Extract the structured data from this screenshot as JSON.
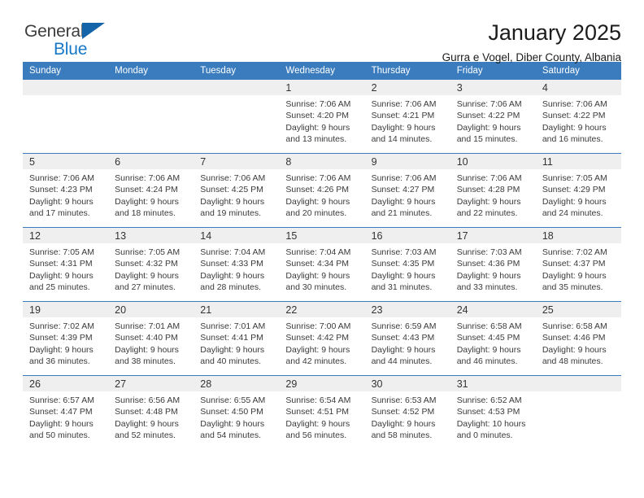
{
  "brand": {
    "name_part1": "General",
    "name_part2": "Blue",
    "triangle_color": "#1464aa"
  },
  "header": {
    "title": "January 2025",
    "subtitle": "Gurra e Vogel, Diber County, Albania"
  },
  "theme": {
    "header_blue": "#3a7cbe",
    "daynum_background": "#efefef",
    "text": "#333333"
  },
  "calendar": {
    "weekday_headers": [
      "Sunday",
      "Monday",
      "Tuesday",
      "Wednesday",
      "Thursday",
      "Friday",
      "Saturday"
    ],
    "weeks": [
      [
        {
          "day": "",
          "empty": true
        },
        {
          "day": "",
          "empty": true
        },
        {
          "day": "",
          "empty": true
        },
        {
          "day": "1",
          "sunrise": "Sunrise: 7:06 AM",
          "sunset": "Sunset: 4:20 PM",
          "daylight_line1": "Daylight: 9 hours",
          "daylight_line2": "and 13 minutes."
        },
        {
          "day": "2",
          "sunrise": "Sunrise: 7:06 AM",
          "sunset": "Sunset: 4:21 PM",
          "daylight_line1": "Daylight: 9 hours",
          "daylight_line2": "and 14 minutes."
        },
        {
          "day": "3",
          "sunrise": "Sunrise: 7:06 AM",
          "sunset": "Sunset: 4:22 PM",
          "daylight_line1": "Daylight: 9 hours",
          "daylight_line2": "and 15 minutes."
        },
        {
          "day": "4",
          "sunrise": "Sunrise: 7:06 AM",
          "sunset": "Sunset: 4:22 PM",
          "daylight_line1": "Daylight: 9 hours",
          "daylight_line2": "and 16 minutes."
        }
      ],
      [
        {
          "day": "5",
          "sunrise": "Sunrise: 7:06 AM",
          "sunset": "Sunset: 4:23 PM",
          "daylight_line1": "Daylight: 9 hours",
          "daylight_line2": "and 17 minutes."
        },
        {
          "day": "6",
          "sunrise": "Sunrise: 7:06 AM",
          "sunset": "Sunset: 4:24 PM",
          "daylight_line1": "Daylight: 9 hours",
          "daylight_line2": "and 18 minutes."
        },
        {
          "day": "7",
          "sunrise": "Sunrise: 7:06 AM",
          "sunset": "Sunset: 4:25 PM",
          "daylight_line1": "Daylight: 9 hours",
          "daylight_line2": "and 19 minutes."
        },
        {
          "day": "8",
          "sunrise": "Sunrise: 7:06 AM",
          "sunset": "Sunset: 4:26 PM",
          "daylight_line1": "Daylight: 9 hours",
          "daylight_line2": "and 20 minutes."
        },
        {
          "day": "9",
          "sunrise": "Sunrise: 7:06 AM",
          "sunset": "Sunset: 4:27 PM",
          "daylight_line1": "Daylight: 9 hours",
          "daylight_line2": "and 21 minutes."
        },
        {
          "day": "10",
          "sunrise": "Sunrise: 7:06 AM",
          "sunset": "Sunset: 4:28 PM",
          "daylight_line1": "Daylight: 9 hours",
          "daylight_line2": "and 22 minutes."
        },
        {
          "day": "11",
          "sunrise": "Sunrise: 7:05 AM",
          "sunset": "Sunset: 4:29 PM",
          "daylight_line1": "Daylight: 9 hours",
          "daylight_line2": "and 24 minutes."
        }
      ],
      [
        {
          "day": "12",
          "sunrise": "Sunrise: 7:05 AM",
          "sunset": "Sunset: 4:31 PM",
          "daylight_line1": "Daylight: 9 hours",
          "daylight_line2": "and 25 minutes."
        },
        {
          "day": "13",
          "sunrise": "Sunrise: 7:05 AM",
          "sunset": "Sunset: 4:32 PM",
          "daylight_line1": "Daylight: 9 hours",
          "daylight_line2": "and 27 minutes."
        },
        {
          "day": "14",
          "sunrise": "Sunrise: 7:04 AM",
          "sunset": "Sunset: 4:33 PM",
          "daylight_line1": "Daylight: 9 hours",
          "daylight_line2": "and 28 minutes."
        },
        {
          "day": "15",
          "sunrise": "Sunrise: 7:04 AM",
          "sunset": "Sunset: 4:34 PM",
          "daylight_line1": "Daylight: 9 hours",
          "daylight_line2": "and 30 minutes."
        },
        {
          "day": "16",
          "sunrise": "Sunrise: 7:03 AM",
          "sunset": "Sunset: 4:35 PM",
          "daylight_line1": "Daylight: 9 hours",
          "daylight_line2": "and 31 minutes."
        },
        {
          "day": "17",
          "sunrise": "Sunrise: 7:03 AM",
          "sunset": "Sunset: 4:36 PM",
          "daylight_line1": "Daylight: 9 hours",
          "daylight_line2": "and 33 minutes."
        },
        {
          "day": "18",
          "sunrise": "Sunrise: 7:02 AM",
          "sunset": "Sunset: 4:37 PM",
          "daylight_line1": "Daylight: 9 hours",
          "daylight_line2": "and 35 minutes."
        }
      ],
      [
        {
          "day": "19",
          "sunrise": "Sunrise: 7:02 AM",
          "sunset": "Sunset: 4:39 PM",
          "daylight_line1": "Daylight: 9 hours",
          "daylight_line2": "and 36 minutes."
        },
        {
          "day": "20",
          "sunrise": "Sunrise: 7:01 AM",
          "sunset": "Sunset: 4:40 PM",
          "daylight_line1": "Daylight: 9 hours",
          "daylight_line2": "and 38 minutes."
        },
        {
          "day": "21",
          "sunrise": "Sunrise: 7:01 AM",
          "sunset": "Sunset: 4:41 PM",
          "daylight_line1": "Daylight: 9 hours",
          "daylight_line2": "and 40 minutes."
        },
        {
          "day": "22",
          "sunrise": "Sunrise: 7:00 AM",
          "sunset": "Sunset: 4:42 PM",
          "daylight_line1": "Daylight: 9 hours",
          "daylight_line2": "and 42 minutes."
        },
        {
          "day": "23",
          "sunrise": "Sunrise: 6:59 AM",
          "sunset": "Sunset: 4:43 PM",
          "daylight_line1": "Daylight: 9 hours",
          "daylight_line2": "and 44 minutes."
        },
        {
          "day": "24",
          "sunrise": "Sunrise: 6:58 AM",
          "sunset": "Sunset: 4:45 PM",
          "daylight_line1": "Daylight: 9 hours",
          "daylight_line2": "and 46 minutes."
        },
        {
          "day": "25",
          "sunrise": "Sunrise: 6:58 AM",
          "sunset": "Sunset: 4:46 PM",
          "daylight_line1": "Daylight: 9 hours",
          "daylight_line2": "and 48 minutes."
        }
      ],
      [
        {
          "day": "26",
          "sunrise": "Sunrise: 6:57 AM",
          "sunset": "Sunset: 4:47 PM",
          "daylight_line1": "Daylight: 9 hours",
          "daylight_line2": "and 50 minutes."
        },
        {
          "day": "27",
          "sunrise": "Sunrise: 6:56 AM",
          "sunset": "Sunset: 4:48 PM",
          "daylight_line1": "Daylight: 9 hours",
          "daylight_line2": "and 52 minutes."
        },
        {
          "day": "28",
          "sunrise": "Sunrise: 6:55 AM",
          "sunset": "Sunset: 4:50 PM",
          "daylight_line1": "Daylight: 9 hours",
          "daylight_line2": "and 54 minutes."
        },
        {
          "day": "29",
          "sunrise": "Sunrise: 6:54 AM",
          "sunset": "Sunset: 4:51 PM",
          "daylight_line1": "Daylight: 9 hours",
          "daylight_line2": "and 56 minutes."
        },
        {
          "day": "30",
          "sunrise": "Sunrise: 6:53 AM",
          "sunset": "Sunset: 4:52 PM",
          "daylight_line1": "Daylight: 9 hours",
          "daylight_line2": "and 58 minutes."
        },
        {
          "day": "31",
          "sunrise": "Sunrise: 6:52 AM",
          "sunset": "Sunset: 4:53 PM",
          "daylight_line1": "Daylight: 10 hours",
          "daylight_line2": "and 0 minutes."
        },
        {
          "day": "",
          "empty": true
        }
      ]
    ]
  }
}
